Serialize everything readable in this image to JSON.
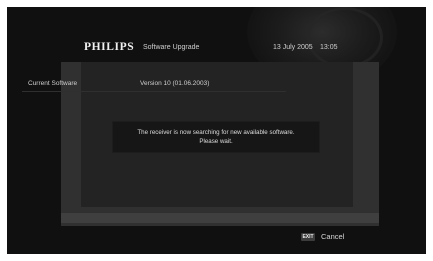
{
  "header": {
    "brand": "PHILIPS",
    "title": "Software Upgrade",
    "date": "13 July 2005",
    "time": "13:05"
  },
  "info": {
    "label": "Current Software",
    "value": "Version 10 (01.06.2003)"
  },
  "message": {
    "line1": "The receiver is now searching for new available software.",
    "line2": "Please wait."
  },
  "footer": {
    "exit_key": "EXIT",
    "cancel_label": "Cancel"
  }
}
